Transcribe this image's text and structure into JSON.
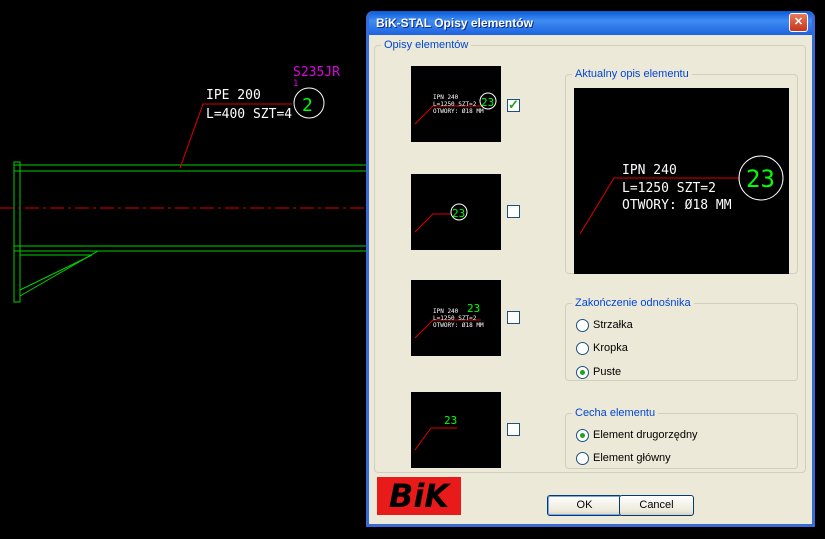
{
  "cad": {
    "section_label": "IPE 200",
    "length_label": "L=400  SZT=4",
    "material_label": "S235JR",
    "material_index": "1",
    "element_number": "2"
  },
  "dialog": {
    "title": "BiK-STAL Opisy elementów",
    "close_symbol": "✕",
    "styles_group": {
      "label": "Opisy elementów",
      "options": [
        {
          "lines": [
            "IPN 240",
            "L=1250 SZT=2",
            "OTWORY: Ø18 MM"
          ],
          "number": "23",
          "checked": true
        },
        {
          "lines": [],
          "number": "23",
          "checked": false
        },
        {
          "lines": [
            "IPN 240",
            "L=1250 SZT=2",
            "OTWORY: Ø18 MM"
          ],
          "number": "23",
          "checked": false
        },
        {
          "lines": [],
          "number": "23",
          "checked": false
        }
      ]
    },
    "preview_group": {
      "label": "Aktualny opis elementu",
      "lines": [
        "IPN 240",
        "L=1250  SZT=2",
        "OTWORY: Ø18 MM"
      ],
      "number": "23"
    },
    "ending_group": {
      "label": "Zakończenie odnośnika",
      "options": [
        "Strzałka",
        "Kropka",
        "Puste"
      ],
      "selected": "Puste"
    },
    "feature_group": {
      "label": "Cecha elementu",
      "options": [
        "Element drugorzędny",
        "Element główny"
      ],
      "selected": "Element drugorzędny"
    },
    "logo_text": "BiK",
    "ok_label": "OK",
    "cancel_label": "Cancel"
  },
  "colors": {
    "leader": "#e00000",
    "structure": "#00e000",
    "text": "#ffffff",
    "material": "#e000e0",
    "axis": "#e00000",
    "number": "#00ff00"
  }
}
